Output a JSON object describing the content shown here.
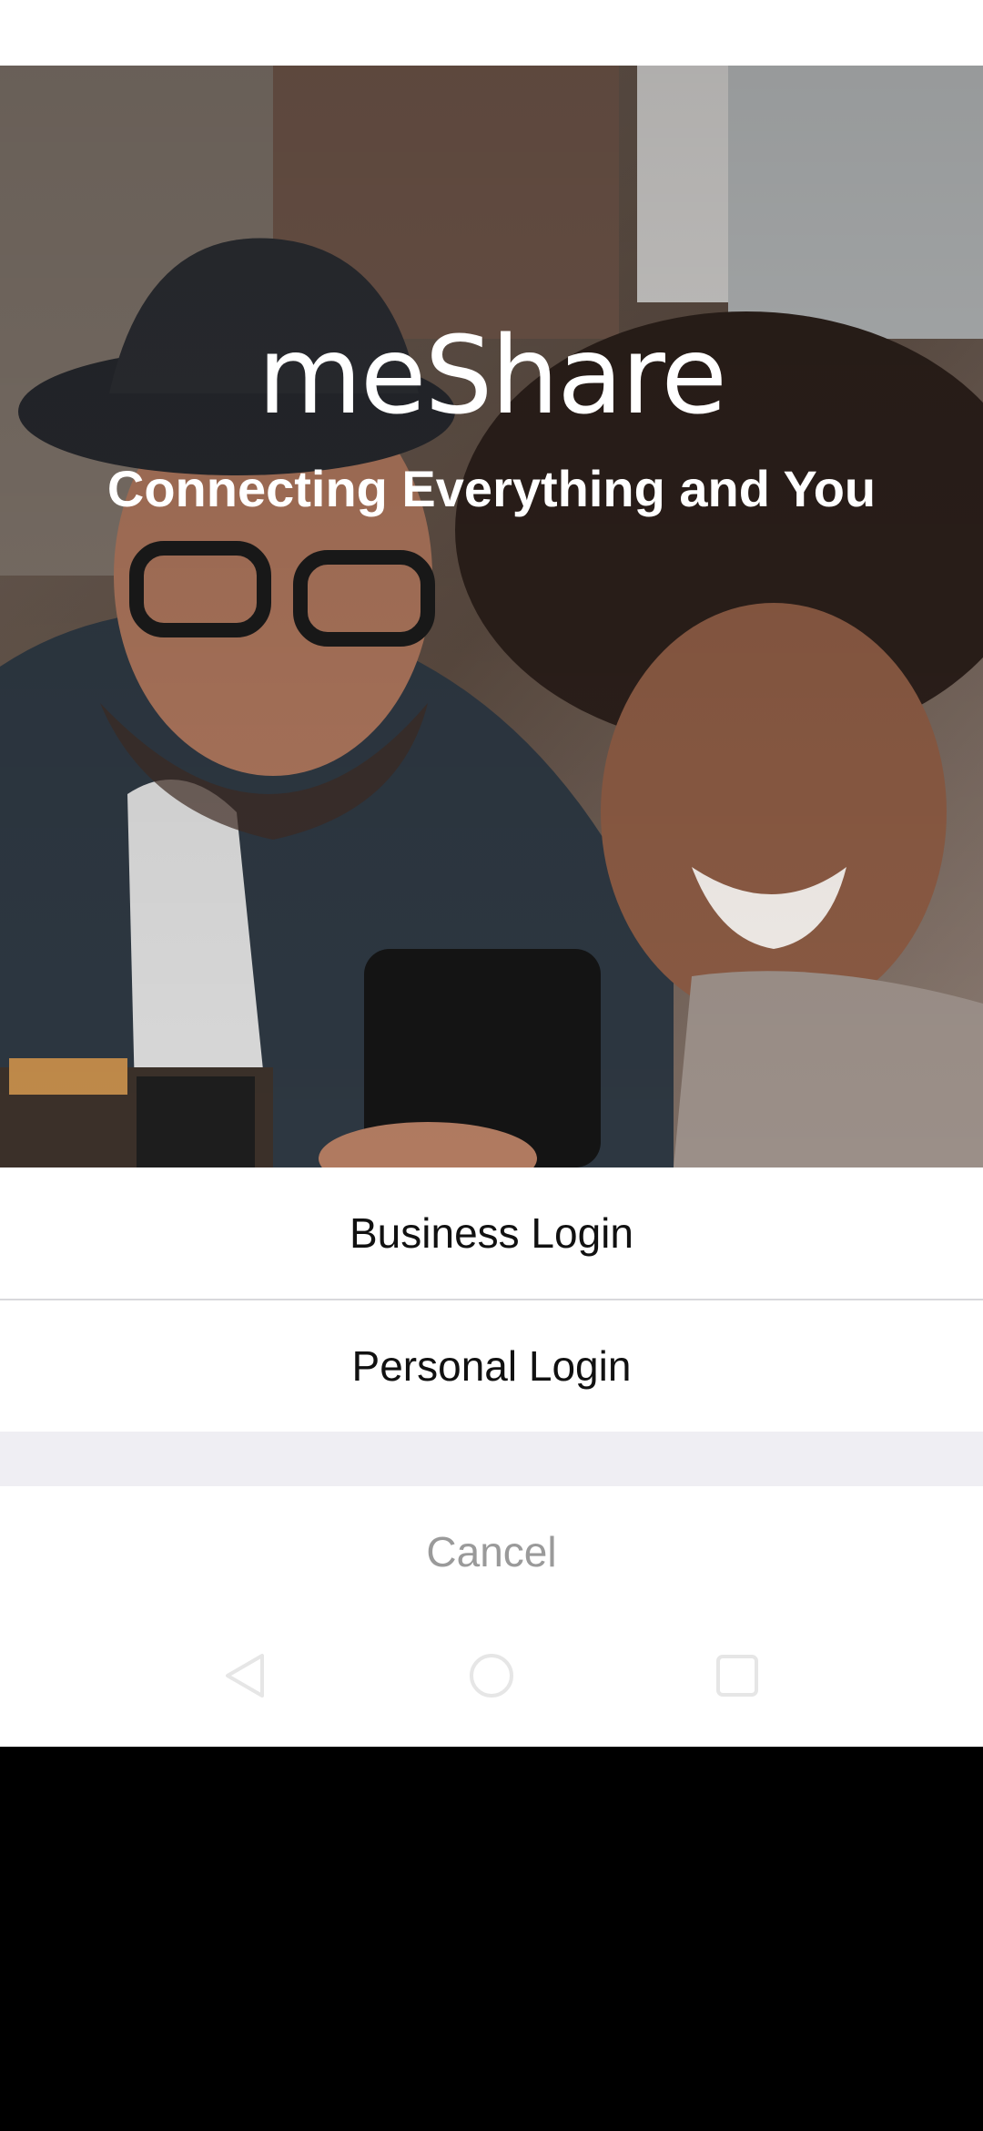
{
  "app": {
    "brand": "meShare",
    "tagline": "Connecting Everything and You"
  },
  "login_sheet": {
    "business_label": "Business Login",
    "personal_label": "Personal Login",
    "cancel_label": "Cancel"
  },
  "navigation": {
    "back_icon": "back-triangle-icon",
    "home_icon": "home-circle-icon",
    "recent_icon": "recent-square-icon"
  },
  "colors": {
    "sheet_background": "#ffffff",
    "divider": "#d8d8dc",
    "gap_background": "#efeef3",
    "cancel_text": "#9a9a9a",
    "option_text": "#111111"
  }
}
